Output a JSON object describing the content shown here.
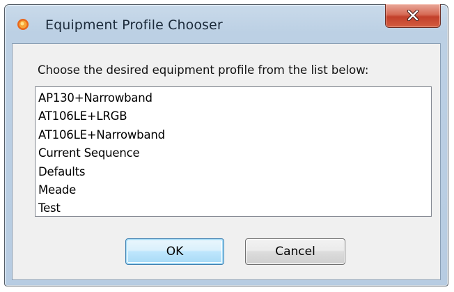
{
  "window": {
    "title": "Equipment Profile Chooser",
    "icon": "orange-sun-app-icon",
    "close_icon": "close-x-icon"
  },
  "dialog": {
    "prompt": "Choose the desired equipment profile from the list below:",
    "profiles": [
      "AP130+Narrowband",
      "AT106LE+LRGB",
      "AT106LE+Narrowband",
      "Current Sequence",
      "Defaults",
      "Meade",
      "Test"
    ],
    "ok_label": "OK",
    "cancel_label": "Cancel"
  },
  "colors": {
    "title_bar": "#bcd0e4",
    "close_button": "#c2402b",
    "dialog_background": "#f0f0f0",
    "default_button": "#bee6fd"
  }
}
